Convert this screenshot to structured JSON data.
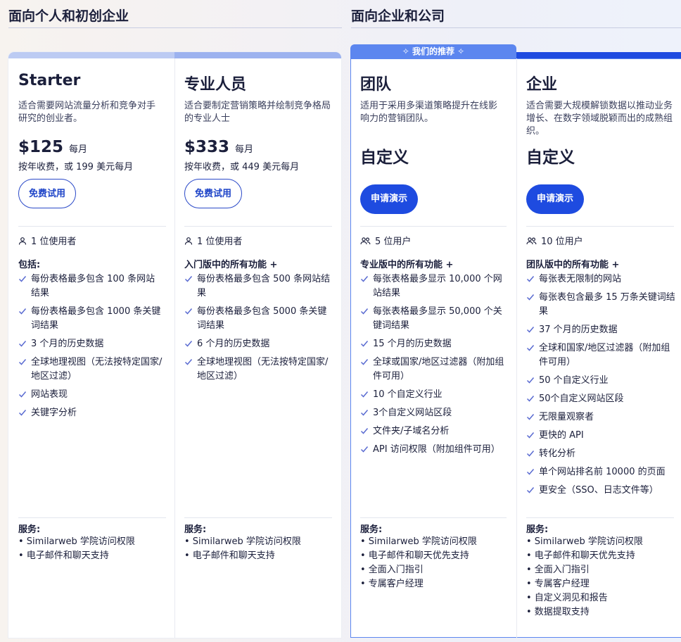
{
  "sections": {
    "individual": "面向个人和初创企业",
    "enterprise": "面向企业和公司"
  },
  "recommended": "我们的推荐",
  "plans": [
    {
      "name": "Starter",
      "desc": "适合需要网站流量分析和竞争对手研究的创业者。",
      "price": "$125",
      "per": "每月",
      "billing": "按年收费，或 199 美元每月",
      "button": "免费试用",
      "users": "1 位使用者",
      "features_head": "包括:",
      "features": [
        "每份表格最多包含 100 条网站结果",
        "每份表格最多包含 1000 条关键词结果",
        "3 个月的历史数据",
        "全球地理视图（无法按特定国家/地区过滤）",
        "网站表现",
        "关键字分析"
      ],
      "services_head": "服务:",
      "services": [
        "• Similarweb 学院访问权限",
        "• 电子邮件和聊天支持"
      ]
    },
    {
      "name": "专业人员",
      "desc": "适合要制定营销策略并绘制竞争格局的专业人士",
      "price": "$333",
      "per": "每月",
      "billing": "按年收费，或 449 美元每月",
      "button": "免费试用",
      "users": "1 位使用者",
      "features_head": "入门版中的所有功能 +",
      "features": [
        "每份表格最多包含 500 条网站结果",
        "每份表格最多包含 5000 条关键词结果",
        "6 个月的历史数据",
        "全球地理视图（无法按特定国家/地区过滤）"
      ],
      "services_head": "服务:",
      "services": [
        "• Similarweb 学院访问权限",
        "• 电子邮件和聊天支持"
      ]
    },
    {
      "name": "团队",
      "desc": "适用于采用多渠道策略提升在线影响力的营销团队。",
      "price": "自定义",
      "button": "申请演示",
      "users": "5 位用户",
      "features_head": "专业版中的所有功能 +",
      "features": [
        "每张表格最多显示 10,000 个网站结果",
        "每张表格最多显示 50,000 个关键词结果",
        "15 个月的历史数据",
        "全球或国家/地区过滤器（附加组件可用）",
        "10 个自定义行业",
        "3个自定义网站区段",
        "文件夹/子域名分析",
        "API 访问权限（附加组件可用）"
      ],
      "services_head": "服务:",
      "services": [
        "• Similarweb 学院访问权限",
        "• 电子邮件和聊天优先支持",
        "• 全面入门指引",
        "• 专属客户经理"
      ]
    },
    {
      "name": "企业",
      "desc": "适合需要大规模解锁数据以推动业务增长、在数字领域脱颖而出的成熟组织。",
      "price": "自定义",
      "button": "申请演示",
      "users": "10 位用户",
      "features_head": "团队版中的所有功能 +",
      "features": [
        "每张表无限制的网站",
        "每张表包含最多 15 万条关键词结果",
        "37 个月的历史数据",
        "全球和国家/地区过滤器（附加组件可用）",
        "50 个自定义行业",
        "50个自定义网站区段",
        "无限量观察者",
        "更快的 API",
        "转化分析",
        "单个网站排名前 10000 的页面",
        "更安全（SSO、日志文件等）"
      ],
      "services_head": "服务:",
      "services": [
        "• Similarweb 学院访问权限",
        "• 电子邮件和聊天优先支持",
        "• 全面入门指引",
        "• 专属客户经理",
        "• 自定义洞见和报告",
        "• 数据提取支持"
      ]
    }
  ],
  "colors": {
    "starter_bar": "#bccbf3",
    "pro_bar": "#9cb2ef",
    "team_bar": "#5c86ef",
    "enterprise_bar": "#1e4be0",
    "accent": "#1e4be0",
    "check": "#5a6bd1"
  }
}
